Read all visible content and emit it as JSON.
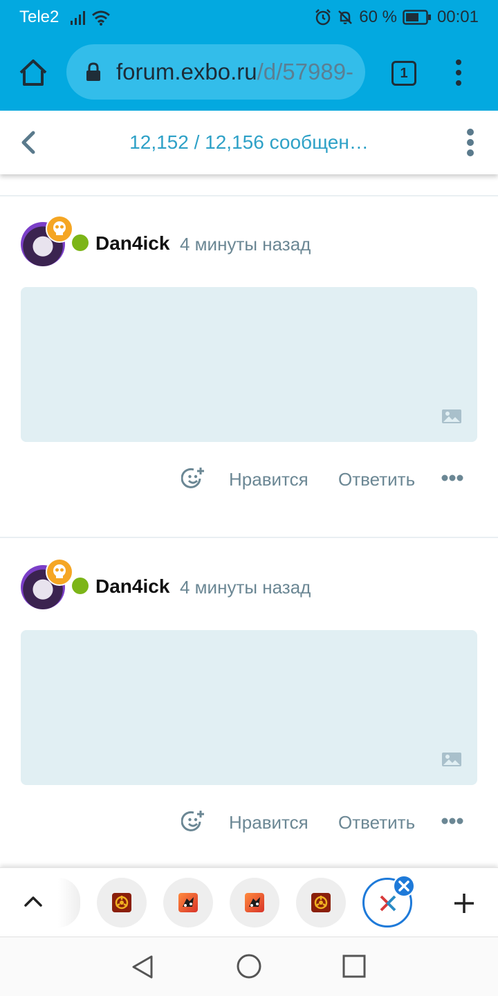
{
  "status_bar": {
    "carrier": "Tele2",
    "battery": "60 %",
    "time": "00:01"
  },
  "browser": {
    "url_host": "forum.exbo.ru",
    "url_path": "/d/57989-",
    "tab_count": "1"
  },
  "page_header": {
    "title": "12,152 / 12,156 сообщен…"
  },
  "posts": [
    {
      "username": "Dan4ick",
      "time": "4 минуты назад",
      "like_label": "Нравится",
      "reply_label": "Ответить"
    },
    {
      "username": "Dan4ick",
      "time": "4 минуты назад",
      "like_label": "Нравится",
      "reply_label": "Ответить"
    }
  ],
  "colors": {
    "toolbar": "#03a9e0",
    "link": "#2ea1c7",
    "online": "#7cb518",
    "badge": "#f5a623",
    "image_placeholder": "#e1eff3"
  }
}
